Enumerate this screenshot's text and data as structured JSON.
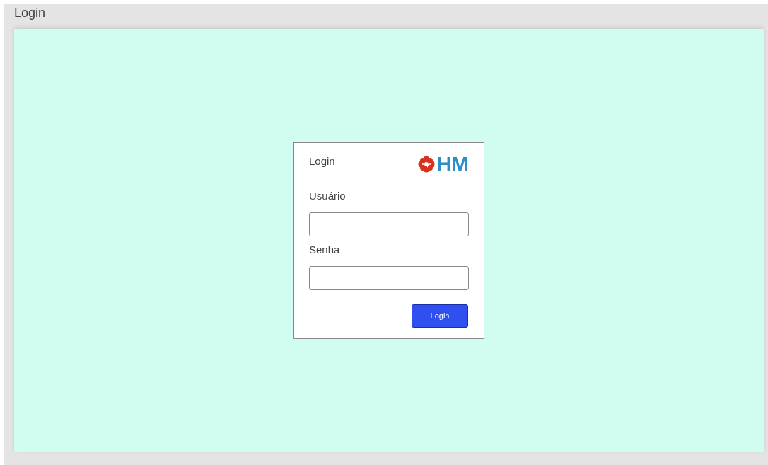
{
  "window": {
    "title": "Login"
  },
  "login_card": {
    "title": "Login",
    "logo_text": "HM",
    "fields": [
      {
        "label": "Usuário"
      },
      {
        "label": "Senha"
      }
    ],
    "button": "Login"
  }
}
